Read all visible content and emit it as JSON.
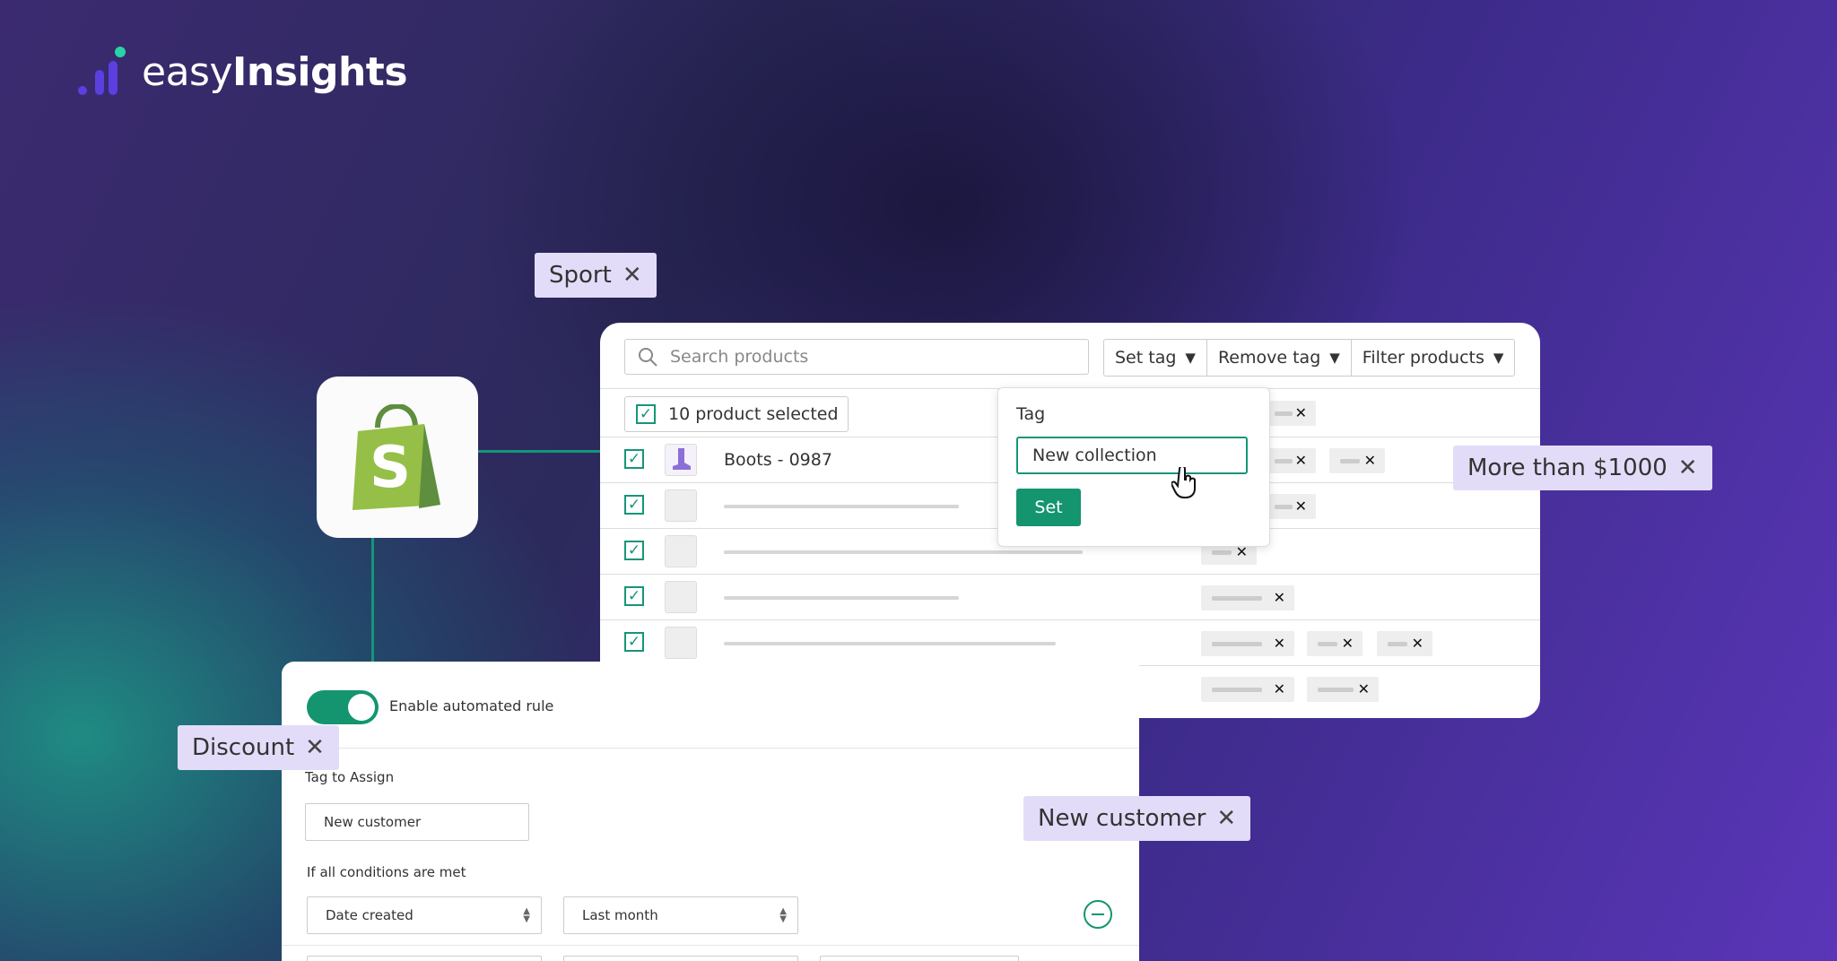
{
  "brand": {
    "name_light": "easy",
    "name_bold": "Insights"
  },
  "floating_tags": [
    {
      "label": "Sport"
    },
    {
      "label": "More than $1000"
    },
    {
      "label": "Discount"
    },
    {
      "label": "New customer"
    }
  ],
  "close_glyph": "✕",
  "products_panel": {
    "search_placeholder": "Search products",
    "actions": [
      {
        "label": "Set tag"
      },
      {
        "label": "Remove tag"
      },
      {
        "label": "Filter products"
      }
    ],
    "caret_glyph": "▼",
    "selected_label": "10 product selected",
    "first_product": "Boots - 0987",
    "check_glyph": "✓",
    "pill_close": "✕"
  },
  "tag_popup": {
    "label": "Tag",
    "input_value": "New collection",
    "set_button": "Set"
  },
  "rule_panel": {
    "toggle_state": "on",
    "enable_label": "Enable automated rule",
    "tag_to_assign_label": "Tag to Assign",
    "tag_value": "New customer",
    "conditions_label": "If all conditions are met",
    "condition_field": "Date created",
    "condition_value": "Last month"
  },
  "colors": {
    "accent": "#14956f",
    "chip_bg": "#e3dcf9",
    "shopify_green": "#95bf47"
  }
}
